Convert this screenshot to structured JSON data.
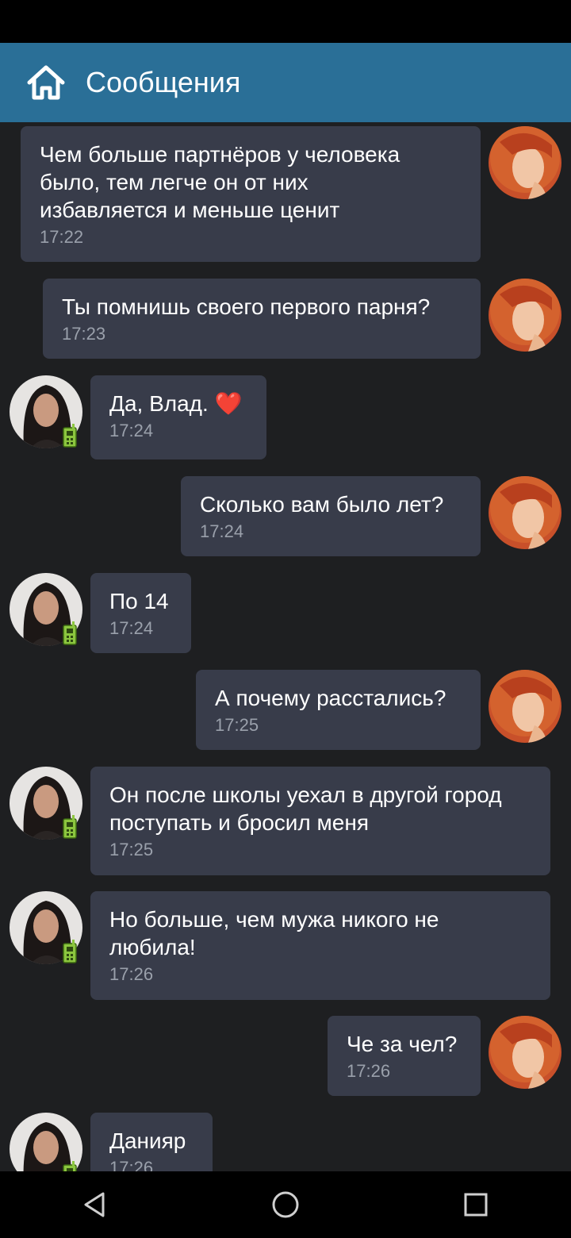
{
  "header": {
    "title": "Сообщения",
    "home_icon": "home-icon"
  },
  "colors": {
    "header": "#2a6f97",
    "bubble": "#383c4a",
    "background": "#1e1f21",
    "time": "#9aa0ab"
  },
  "messages": [
    {
      "side": "out",
      "text": "Чем больше партнёров у человека\nбыло, тем легче он от них\nизбавляется и меньше ценит",
      "time": "17:22"
    },
    {
      "side": "out",
      "text": "Ты помнишь своего первого парня?",
      "time": "17:23"
    },
    {
      "side": "in",
      "text": "Да, Влад.",
      "emoji": "❤️",
      "time": "17:24"
    },
    {
      "side": "out",
      "text": "Сколько вам было лет?",
      "time": "17:24"
    },
    {
      "side": "in",
      "text": "По 14",
      "time": "17:24"
    },
    {
      "side": "out",
      "text": "А почему расстались?",
      "time": "17:25"
    },
    {
      "side": "in",
      "text": "Он после школы уехал в другой город\nпоступать и бросил меня",
      "time": "17:25"
    },
    {
      "side": "in",
      "text": "Но больше, чем мужа никого не\nлюбила!",
      "time": "17:26"
    },
    {
      "side": "out",
      "text": "Че за чел?",
      "time": "17:26"
    },
    {
      "side": "in",
      "text": "Данияр",
      "time": "17:26"
    }
  ],
  "nav": {
    "back": "back-triangle-icon",
    "home": "home-circle-icon",
    "recents": "recents-square-icon"
  }
}
